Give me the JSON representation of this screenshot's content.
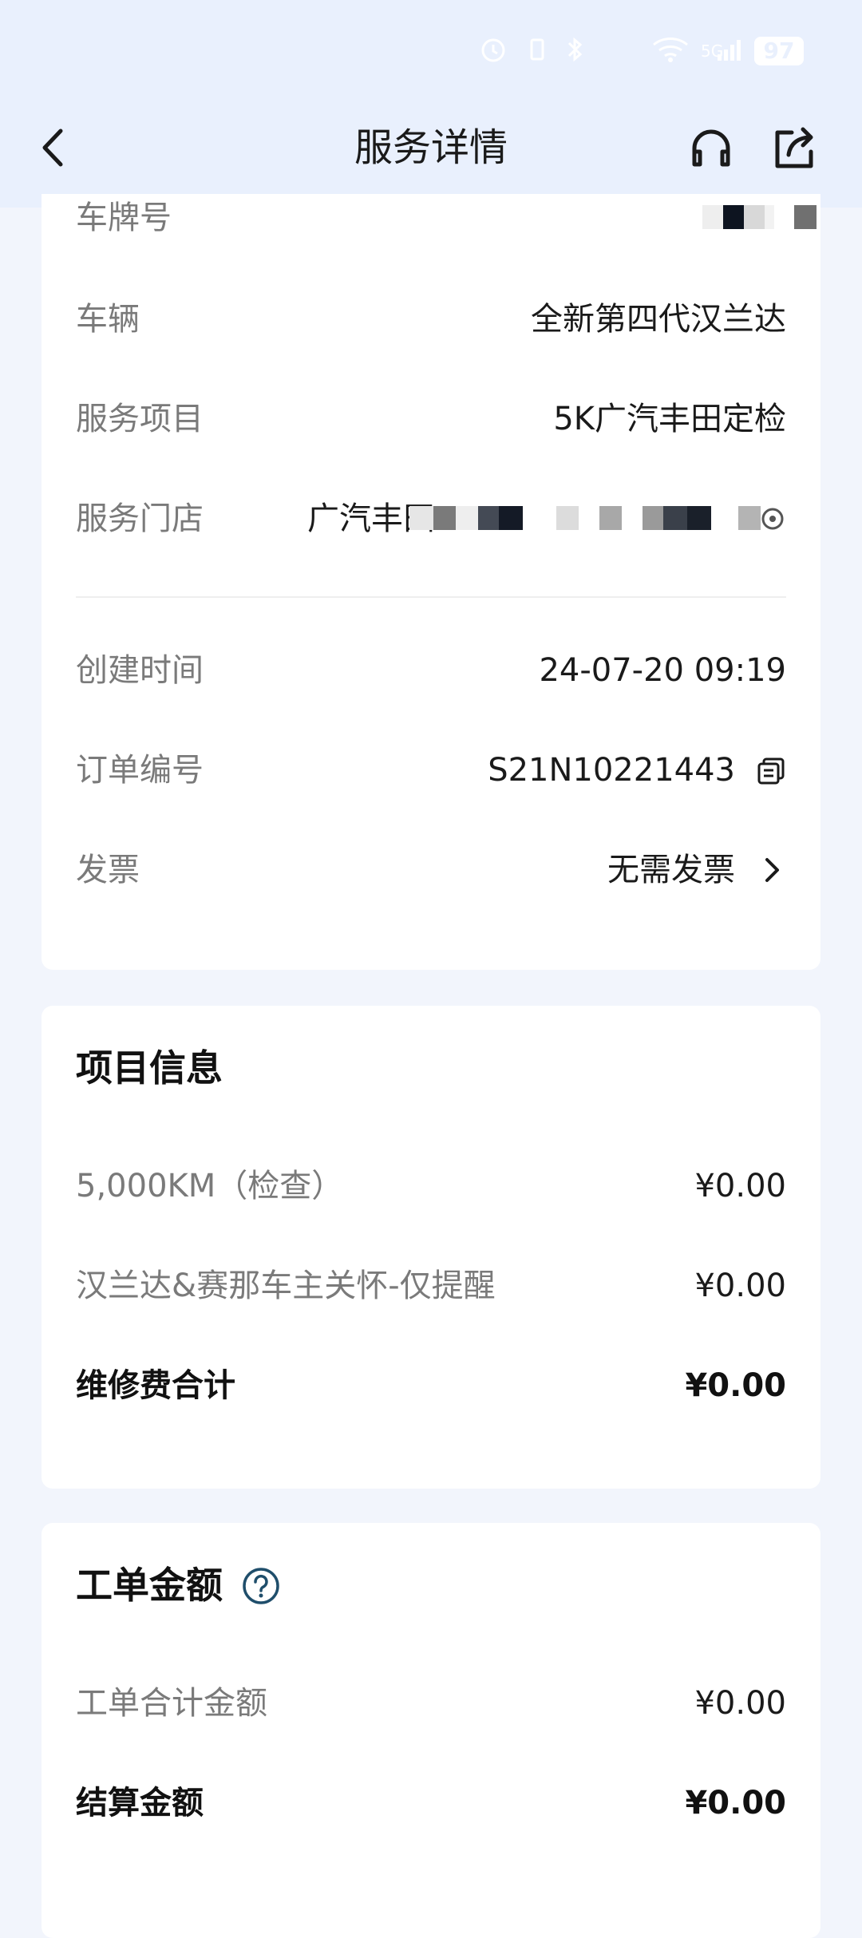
{
  "status_bar": {
    "signal": "5G",
    "battery": "97"
  },
  "header": {
    "title": "服务详情"
  },
  "order_info": {
    "plate_label": "车牌号",
    "vehicle_label": "车辆",
    "vehicle_value": "全新第四代汉兰达",
    "service_label": "服务项目",
    "service_value": "5K广汽丰田定检",
    "store_label": "服务门店",
    "store_value": "广汽丰田",
    "created_label": "创建时间",
    "created_value": "24-07-20 09:19",
    "order_no_label": "订单编号",
    "order_no_value": "S21N10221443",
    "invoice_label": "发票",
    "invoice_value": "无需发票"
  },
  "project_info": {
    "title": "项目信息",
    "items": [
      {
        "name": "5,000KM（检查）",
        "price": "¥0.00"
      },
      {
        "name": "汉兰达&赛那车主关怀-仅提醒",
        "price": "¥0.00"
      }
    ],
    "total_label": "维修费合计",
    "total_value": "¥0.00"
  },
  "work_order": {
    "title": "工单金额",
    "sum_label": "工单合计金额",
    "sum_value": "¥0.00",
    "settle_label": "结算金额",
    "settle_value": "¥0.00"
  },
  "icons": [
    "back-icon",
    "headset-icon",
    "share-icon",
    "copy-icon",
    "chevron-right-icon",
    "help-icon",
    "location-icon"
  ],
  "colors": {
    "background": "#f2f5fc",
    "header_bg": "#e9f0fd",
    "card": "#ffffff",
    "label": "#7a7a7a",
    "text": "#1a1a1a",
    "help_icon": "#1f4e6b"
  }
}
